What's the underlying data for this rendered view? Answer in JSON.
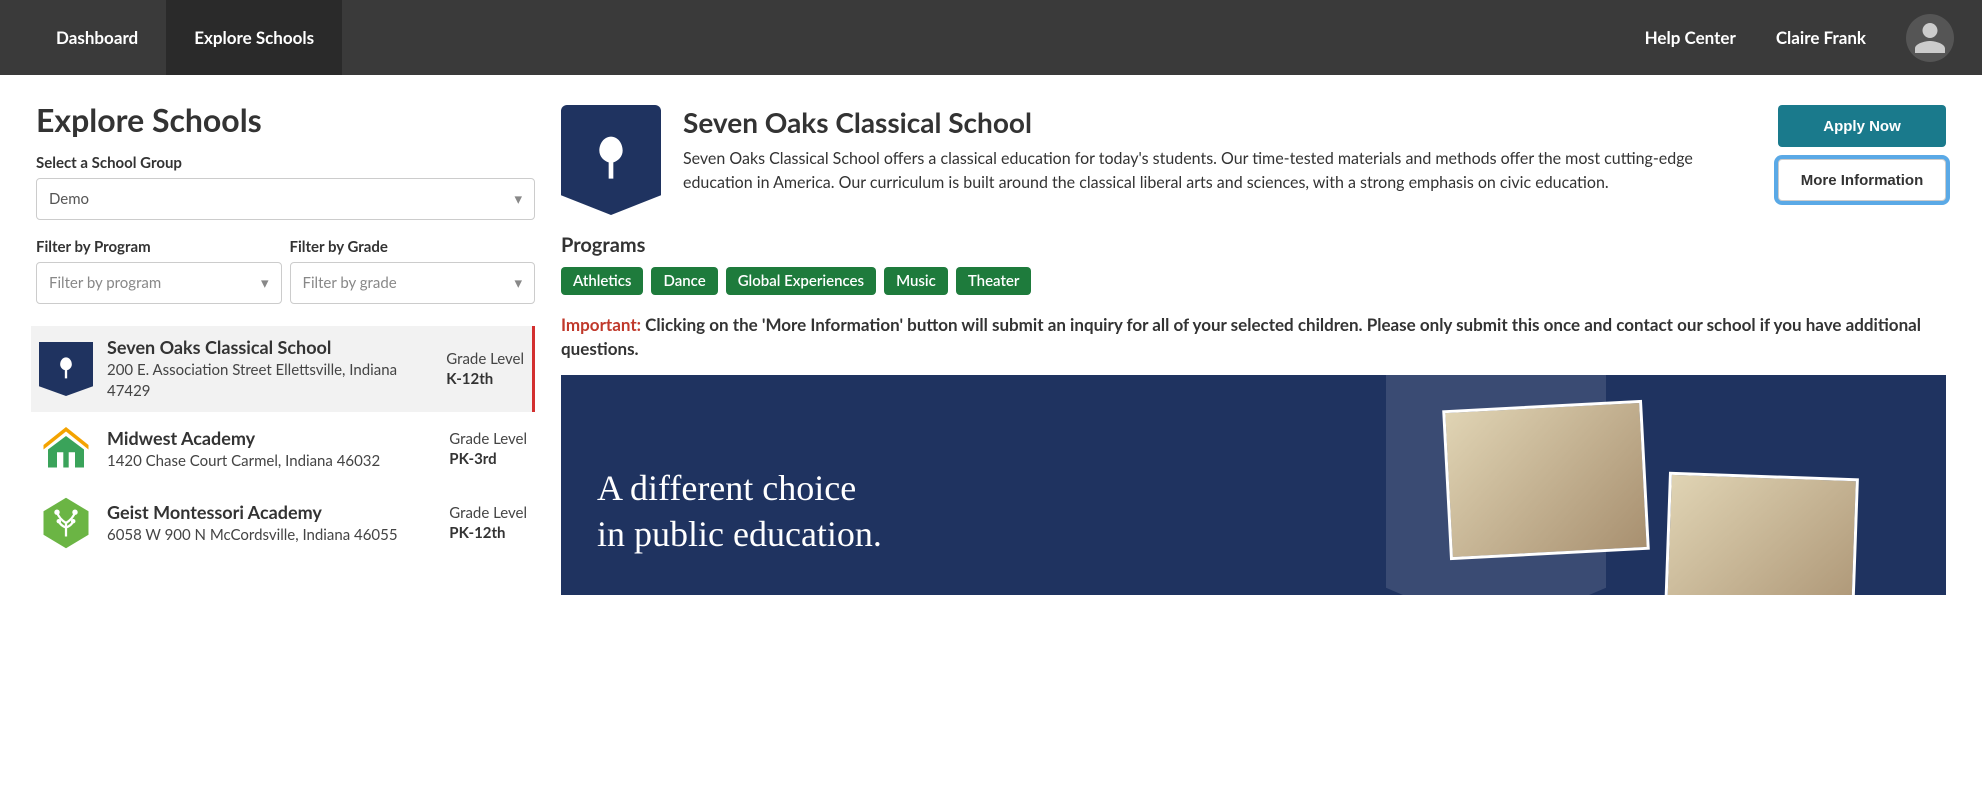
{
  "header": {
    "nav": [
      "Dashboard",
      "Explore Schools"
    ],
    "active_nav": 1,
    "help_center": "Help Center",
    "user_name": "Claire Frank"
  },
  "page": {
    "title": "Explore Schools",
    "group_label": "Select a School Group",
    "group_value": "Demo",
    "filter_program_label": "Filter by Program",
    "filter_program_placeholder": "Filter by program",
    "filter_grade_label": "Filter by Grade",
    "filter_grade_placeholder": "Filter by grade",
    "grade_level_label": "Grade Level"
  },
  "schools": [
    {
      "name": "Seven Oaks Classical School",
      "address": "200 E. Association Street Ellettsville, Indiana 47429",
      "grade": "K-12th",
      "selected": true,
      "logo_colors": {
        "bg": "#1f3360",
        "fg": "#ffffff"
      }
    },
    {
      "name": "Midwest Academy",
      "address": "1420 Chase Court Carmel, Indiana 46032",
      "grade": "PK-3rd",
      "selected": false,
      "logo_colors": {
        "bg": "#f4a300",
        "fg": "#3aa35a"
      }
    },
    {
      "name": "Geist Montessori Academy",
      "address": "6058 W 900 N McCordsville, Indiana 46055",
      "grade": "PK-12th",
      "selected": false,
      "logo_colors": {
        "bg": "#6bb544",
        "fg": "#ffffff"
      }
    }
  ],
  "detail": {
    "title": "Seven Oaks Classical School",
    "description": "Seven Oaks Classical School offers a classical education for today's students. Our time-tested materials and methods offer the most cutting-edge education in America. Our curriculum is built around the classical liberal arts and sciences, with a strong emphasis on civic education.",
    "apply_label": "Apply Now",
    "more_info_label": "More Information",
    "programs_heading": "Programs",
    "programs": [
      "Athletics",
      "Dance",
      "Global Experiences",
      "Music",
      "Theater"
    ],
    "important_prefix": "Important:",
    "important_text": " Clicking on the 'More Information' button will submit an inquiry for all of your selected children. Please only submit this once and contact our school if you have additional questions.",
    "hero_line1": "A different choice",
    "hero_line2": "in public education."
  }
}
